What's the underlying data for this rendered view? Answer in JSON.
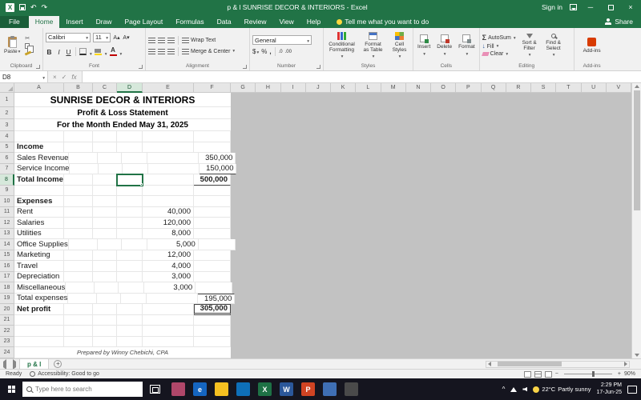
{
  "title_bar": {
    "app_title": "p & l SUNRISE DECOR & INTERIORS - Excel",
    "sign_in": "Sign in"
  },
  "ribbon_tabs": {
    "file": "File",
    "tabs": [
      "Home",
      "Insert",
      "Draw",
      "Page Layout",
      "Formulas",
      "Data",
      "Review",
      "View",
      "Help"
    ],
    "active_tab": "Home",
    "tell_me": "Tell me what you want to do",
    "share": "Share"
  },
  "ribbon": {
    "clipboard": {
      "label": "Clipboard",
      "paste": "Paste"
    },
    "font": {
      "label": "Font",
      "name": "Calibri",
      "size": "11",
      "bold": "B",
      "italic": "I",
      "underline": "U"
    },
    "alignment": {
      "label": "Alignment",
      "wrap": "Wrap Text",
      "merge": "Merge & Center"
    },
    "number": {
      "label": "Number",
      "format": "General"
    },
    "styles": {
      "label": "Styles",
      "conditional": "Conditional Formatting",
      "table": "Format as Table",
      "cell_styles": "Cell Styles"
    },
    "cells": {
      "label": "Cells",
      "insert": "Insert",
      "delete": "Delete",
      "format": "Format"
    },
    "editing": {
      "label": "Editing",
      "autosum": "AutoSum",
      "fill": "Fill",
      "clear": "Clear",
      "sort": "Sort & Filter",
      "find": "Find & Select"
    },
    "addins": {
      "label": "Add-ins",
      "button": "Add-ins"
    }
  },
  "formula_bar": {
    "name_box": "D8",
    "formula": ""
  },
  "sheet": {
    "columns": [
      "A",
      "B",
      "C",
      "D",
      "E",
      "F",
      "G",
      "H",
      "I",
      "J",
      "K",
      "L",
      "M",
      "N",
      "O",
      "P",
      "Q",
      "R",
      "S",
      "T",
      "U",
      "V"
    ],
    "selected_cell": {
      "col": "D",
      "row": 8
    },
    "rows": [
      {
        "n": 1,
        "a": "SUNRISE DECOR & INTERIORS",
        "style": "t1",
        "merged": true
      },
      {
        "n": 2,
        "a": "Profit & Loss Statement",
        "style": "t2",
        "merged": true
      },
      {
        "n": 3,
        "a": "For the Month Ended May 31, 2025",
        "style": "t2",
        "merged": true
      },
      {
        "n": 4
      },
      {
        "n": 5,
        "a": "Income",
        "bold": true
      },
      {
        "n": 6,
        "a": "Sales Revenue",
        "f": "350,000"
      },
      {
        "n": 7,
        "a": "Service Income",
        "f": "150,000",
        "f_bottom": true
      },
      {
        "n": 8,
        "a": "Total Income",
        "bold": true,
        "f": "500,000",
        "f_bottom": true
      },
      {
        "n": 9
      },
      {
        "n": 10,
        "a": "Expenses",
        "bold": true
      },
      {
        "n": 11,
        "a": "Rent",
        "e": "40,000"
      },
      {
        "n": 12,
        "a": "Salaries",
        "e": "120,000"
      },
      {
        "n": 13,
        "a": "Utilities",
        "e": "8,000"
      },
      {
        "n": 14,
        "a": "Office Supplies",
        "e": "5,000"
      },
      {
        "n": 15,
        "a": "Marketing",
        "e": "12,000"
      },
      {
        "n": 16,
        "a": "Travel",
        "e": "4,000"
      },
      {
        "n": 17,
        "a": "Depreciation",
        "e": "3,000"
      },
      {
        "n": 18,
        "a": "Miscellaneous",
        "e": "3,000"
      },
      {
        "n": 19,
        "a": "Total expenses",
        "f": "195,000",
        "f_top": true
      },
      {
        "n": 20,
        "a": "Net profit",
        "bold": true,
        "f": "305,000",
        "f_box": true
      },
      {
        "n": 21
      },
      {
        "n": 22
      },
      {
        "n": 23
      },
      {
        "n": 24,
        "a": "Prepared by Winny Chebichi, CPA",
        "style": "footer",
        "merged": true
      }
    ]
  },
  "sheet_tabs": {
    "active": "p & l"
  },
  "status_bar": {
    "mode": "Ready",
    "accessibility": "Accessibility: Good to go",
    "zoom": "90%"
  },
  "taskbar": {
    "search_placeholder": "Type here to search",
    "weather_temp": "22°C",
    "weather_text": "Partly sunny",
    "time": "2:29 PM",
    "date": "17-Jun-25",
    "apps": [
      {
        "name": "photos-app-icon",
        "color": "#b0476a",
        "glyph": ""
      },
      {
        "name": "edge-browser-icon",
        "color": "#1565c0",
        "glyph": "e"
      },
      {
        "name": "file-explorer-icon",
        "color": "#f5c021",
        "glyph": ""
      },
      {
        "name": "store-app-icon",
        "color": "#0e6fb8",
        "glyph": ""
      },
      {
        "name": "excel-app-icon",
        "color": "#1e7145",
        "glyph": "X"
      },
      {
        "name": "word-app-icon",
        "color": "#2b579a",
        "glyph": "W"
      },
      {
        "name": "powerpoint-app-icon",
        "color": "#d04423",
        "glyph": "P"
      },
      {
        "name": "notes-app-icon",
        "color": "#3f6fb4",
        "glyph": ""
      },
      {
        "name": "settings-app-icon",
        "color": "#4a4a4a",
        "glyph": ""
      }
    ]
  },
  "icons": {
    "excel_logo": "X",
    "undo": "↶",
    "redo": "↷",
    "minimize": "─",
    "close": "×",
    "scissors": "✂",
    "grow_font": "A▴",
    "shrink_font": "A▾",
    "font_color_letter": "A",
    "currency": "$",
    "percent": "%",
    "comma": ",",
    "decimal_increase": ".0",
    "decimal_decrease": ".00",
    "sigma": "Σ",
    "fill_arrow": "↓",
    "cancel": "×",
    "check": "✓",
    "fx": "fx",
    "new_sheet": "+",
    "zoom_out": "−",
    "zoom_in": "+",
    "tray_caret": "^"
  }
}
